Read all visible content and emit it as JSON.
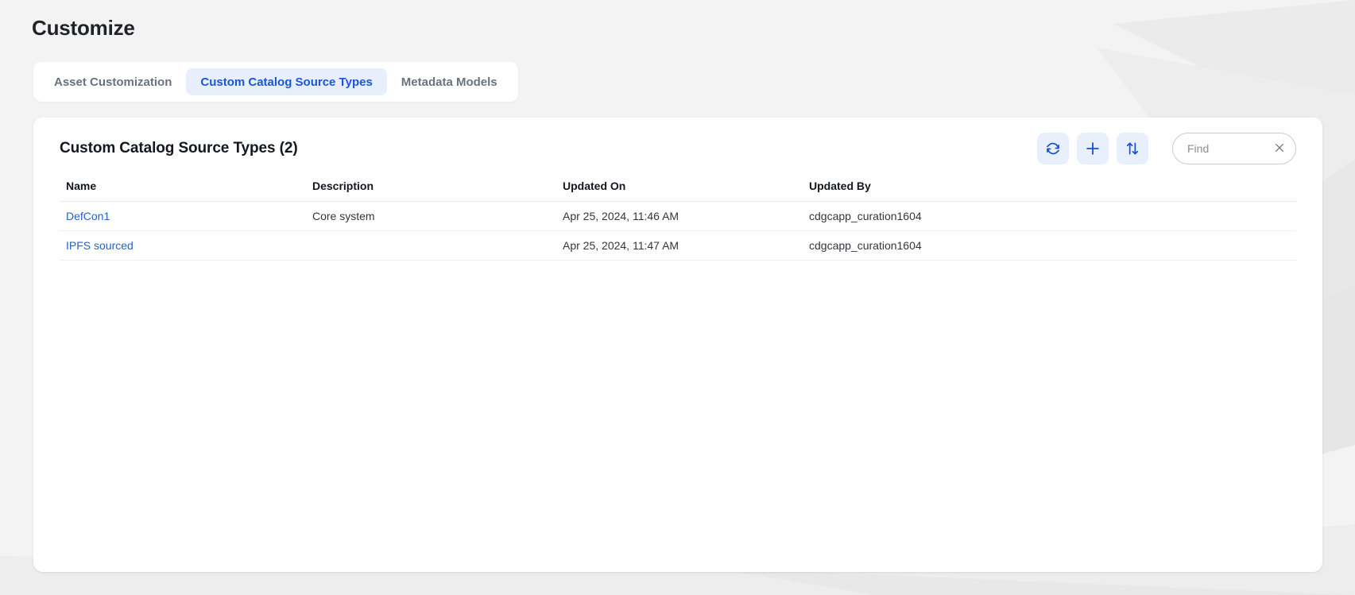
{
  "page": {
    "title": "Customize",
    "background_color": "#f3f3f4"
  },
  "tabs": [
    {
      "label": "Asset Customization",
      "active": false
    },
    {
      "label": "Custom Catalog Source Types",
      "active": true
    },
    {
      "label": "Metadata Models",
      "active": false
    }
  ],
  "card": {
    "title": "Custom Catalog Source Types (2)",
    "count": 2,
    "toolbar": {
      "refresh_icon": "refresh-icon",
      "add_icon": "plus-icon",
      "sort_icon": "sort-arrows-icon",
      "accent_color": "#1a56db",
      "icon_button_bg": "#e9f0fd"
    },
    "search": {
      "placeholder": "Find",
      "value": "",
      "clear_icon": "close-icon"
    },
    "table": {
      "columns": [
        "Name",
        "Description",
        "Updated On",
        "Updated By"
      ],
      "rows": [
        {
          "name": "DefCon1",
          "description": "Core system",
          "updated_on": "Apr 25, 2024, 11:46 AM",
          "updated_by": "cdgcapp_curation1604"
        },
        {
          "name": "IPFS sourced",
          "description": "",
          "updated_on": "Apr 25, 2024, 11:47 AM",
          "updated_by": "cdgcapp_curation1604"
        }
      ]
    }
  }
}
